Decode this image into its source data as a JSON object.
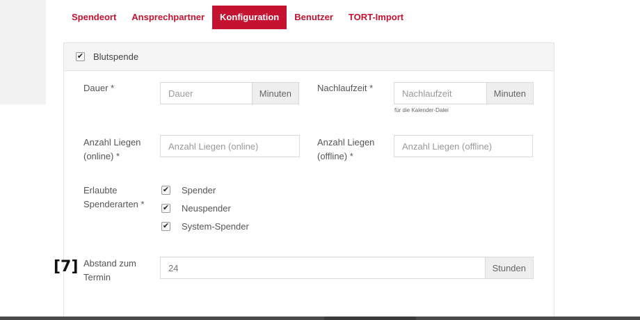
{
  "tabs": [
    {
      "label": "Spendeort",
      "active": false
    },
    {
      "label": "Ansprechpartner",
      "active": false
    },
    {
      "label": "Konfiguration",
      "active": true
    },
    {
      "label": "Benutzer",
      "active": false
    },
    {
      "label": "TORT-Import",
      "active": false
    }
  ],
  "section": {
    "title": "Blutspende",
    "checked": true
  },
  "fields": {
    "dauer": {
      "label": "Dauer *",
      "placeholder": "Dauer",
      "unit": "Minuten"
    },
    "nachlaufzeit": {
      "label": "Nachlaufzeit *",
      "placeholder": "Nachlaufzeit",
      "unit": "Minuten",
      "hint": "für die Kalender-Datei"
    },
    "liegen_online": {
      "label_line1": "Anzahl Liegen",
      "label_line2": "(online) *",
      "placeholder": "Anzahl Liegen (online)"
    },
    "liegen_offline": {
      "label_line1": "Anzahl Liegen",
      "label_line2": "(offline) *",
      "placeholder": "Anzahl Liegen (offline)"
    },
    "spenderarten": {
      "label_line1": "Erlaubte",
      "label_line2": "Spenderarten *",
      "options": [
        {
          "label": "Spender",
          "checked": true
        },
        {
          "label": "Neuspender",
          "checked": true
        },
        {
          "label": "System-Spender",
          "checked": true
        }
      ]
    },
    "abstand": {
      "label_line1": "Abstand zum",
      "label_line2": "Termin",
      "value": "24",
      "unit": "Stunden"
    }
  },
  "marker": "[7]",
  "icons": {
    "checkbox": "checkmark-icon",
    "check_glyph": "✔"
  },
  "colors": {
    "accent": "#c41230",
    "addon_bg": "#eeeeee",
    "panel_head_bg": "#f5f5f5"
  }
}
